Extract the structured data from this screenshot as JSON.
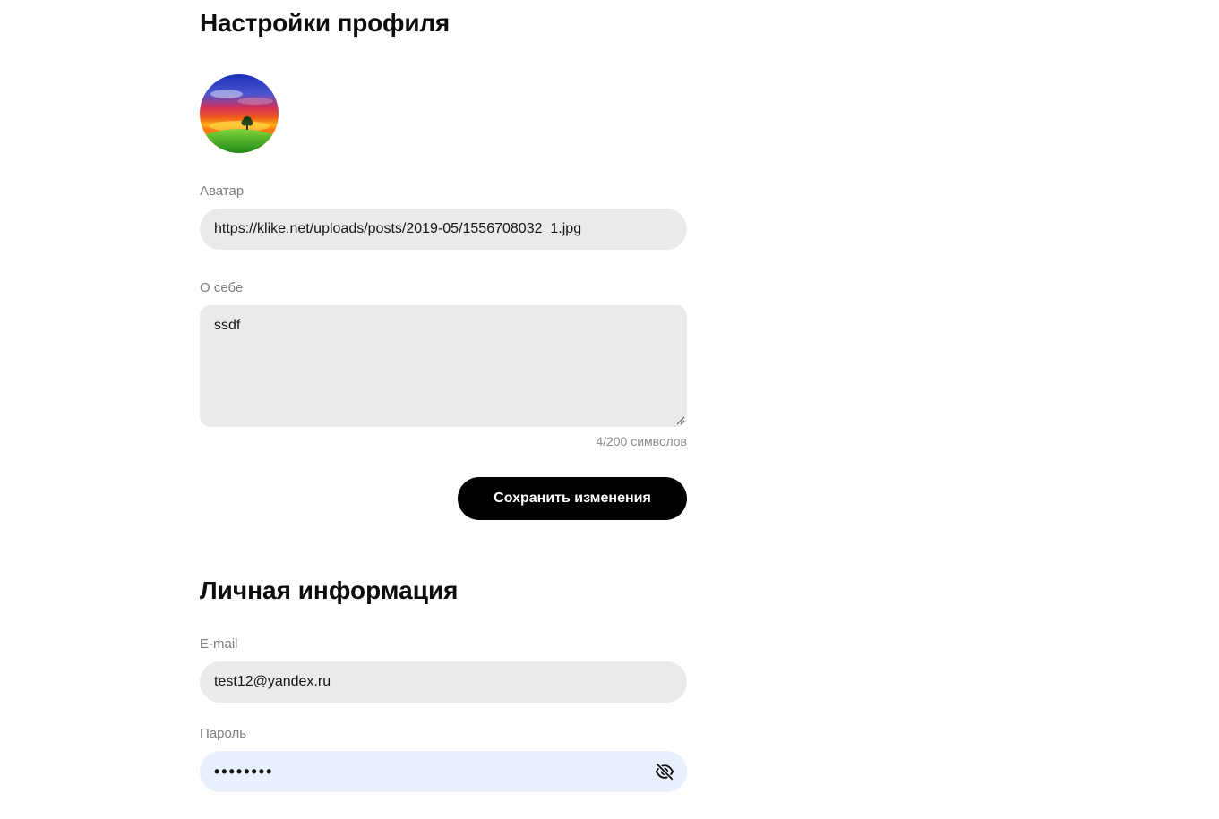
{
  "profile_settings": {
    "title": "Настройки профиля",
    "avatar_label": "Аватар",
    "avatar_url_value": "https://klike.net/uploads/posts/2019-05/1556708032_1.jpg",
    "about_label": "О себе",
    "about_value": "ssdf",
    "counter_text": "4/200 символов",
    "save_button_label": "Сохранить изменения"
  },
  "personal_info": {
    "title": "Личная информация",
    "email_label": "E-mail",
    "email_value": "test12@yandex.ru",
    "password_label": "Пароль",
    "password_masked": "••••••••",
    "toggle_icon": "eye-off-icon"
  },
  "colors": {
    "field_bg": "#e9eaeb",
    "autofill_bg": "#e8f0fe",
    "button_bg": "#000000",
    "label_text": "#7d7d7d"
  }
}
